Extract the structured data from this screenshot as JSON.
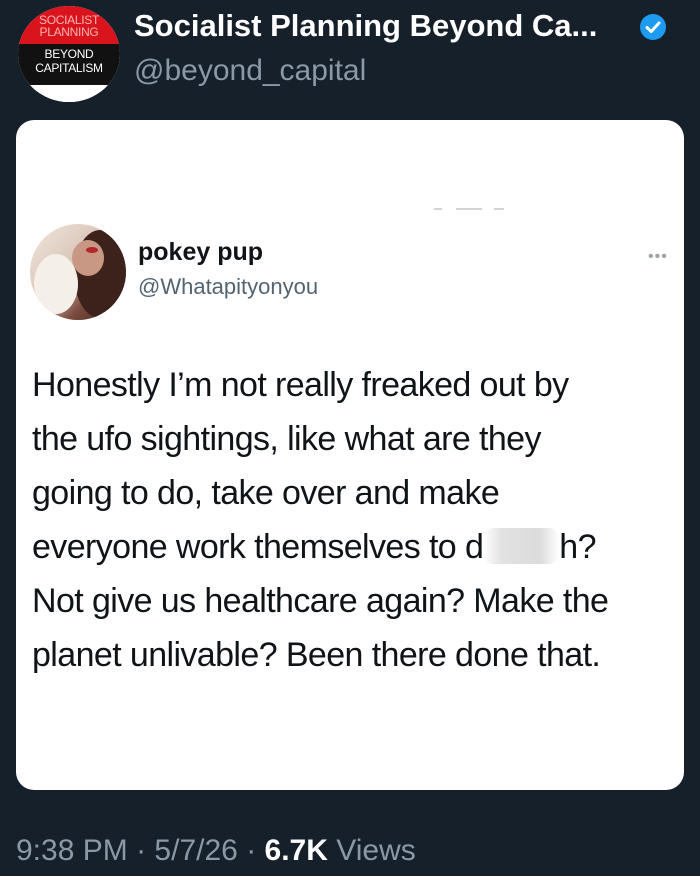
{
  "account": {
    "name": "Socialist Planning Beyond Ca...",
    "handle": "@beyond_capital",
    "logo_lines": [
      "SOCIALIST",
      "PLANNING",
      "BEYOND",
      "CAPITALISM"
    ],
    "verified_icon": "verified-badge-icon",
    "accent_color": "#1d9bf0"
  },
  "quoted_post": {
    "author_name": "pokey pup",
    "author_handle": "@Whatapityonyou",
    "more_icon": "more-options-icon",
    "text_lines": [
      "Honestly I’m not really freaked out by",
      "the ufo sightings, like what are they",
      "going to do, take over and make"
    ],
    "line4_before": "everyone work themselves to d",
    "line4_after": "h?",
    "text_lines_end": [
      "Not give us healthcare again? Make the",
      "planet unlivable? Been there done that."
    ]
  },
  "footer": {
    "time": "9:38 PM",
    "separator": "·",
    "date": "5/7/26",
    "views_count": "6.7K",
    "views_label": "Views"
  }
}
